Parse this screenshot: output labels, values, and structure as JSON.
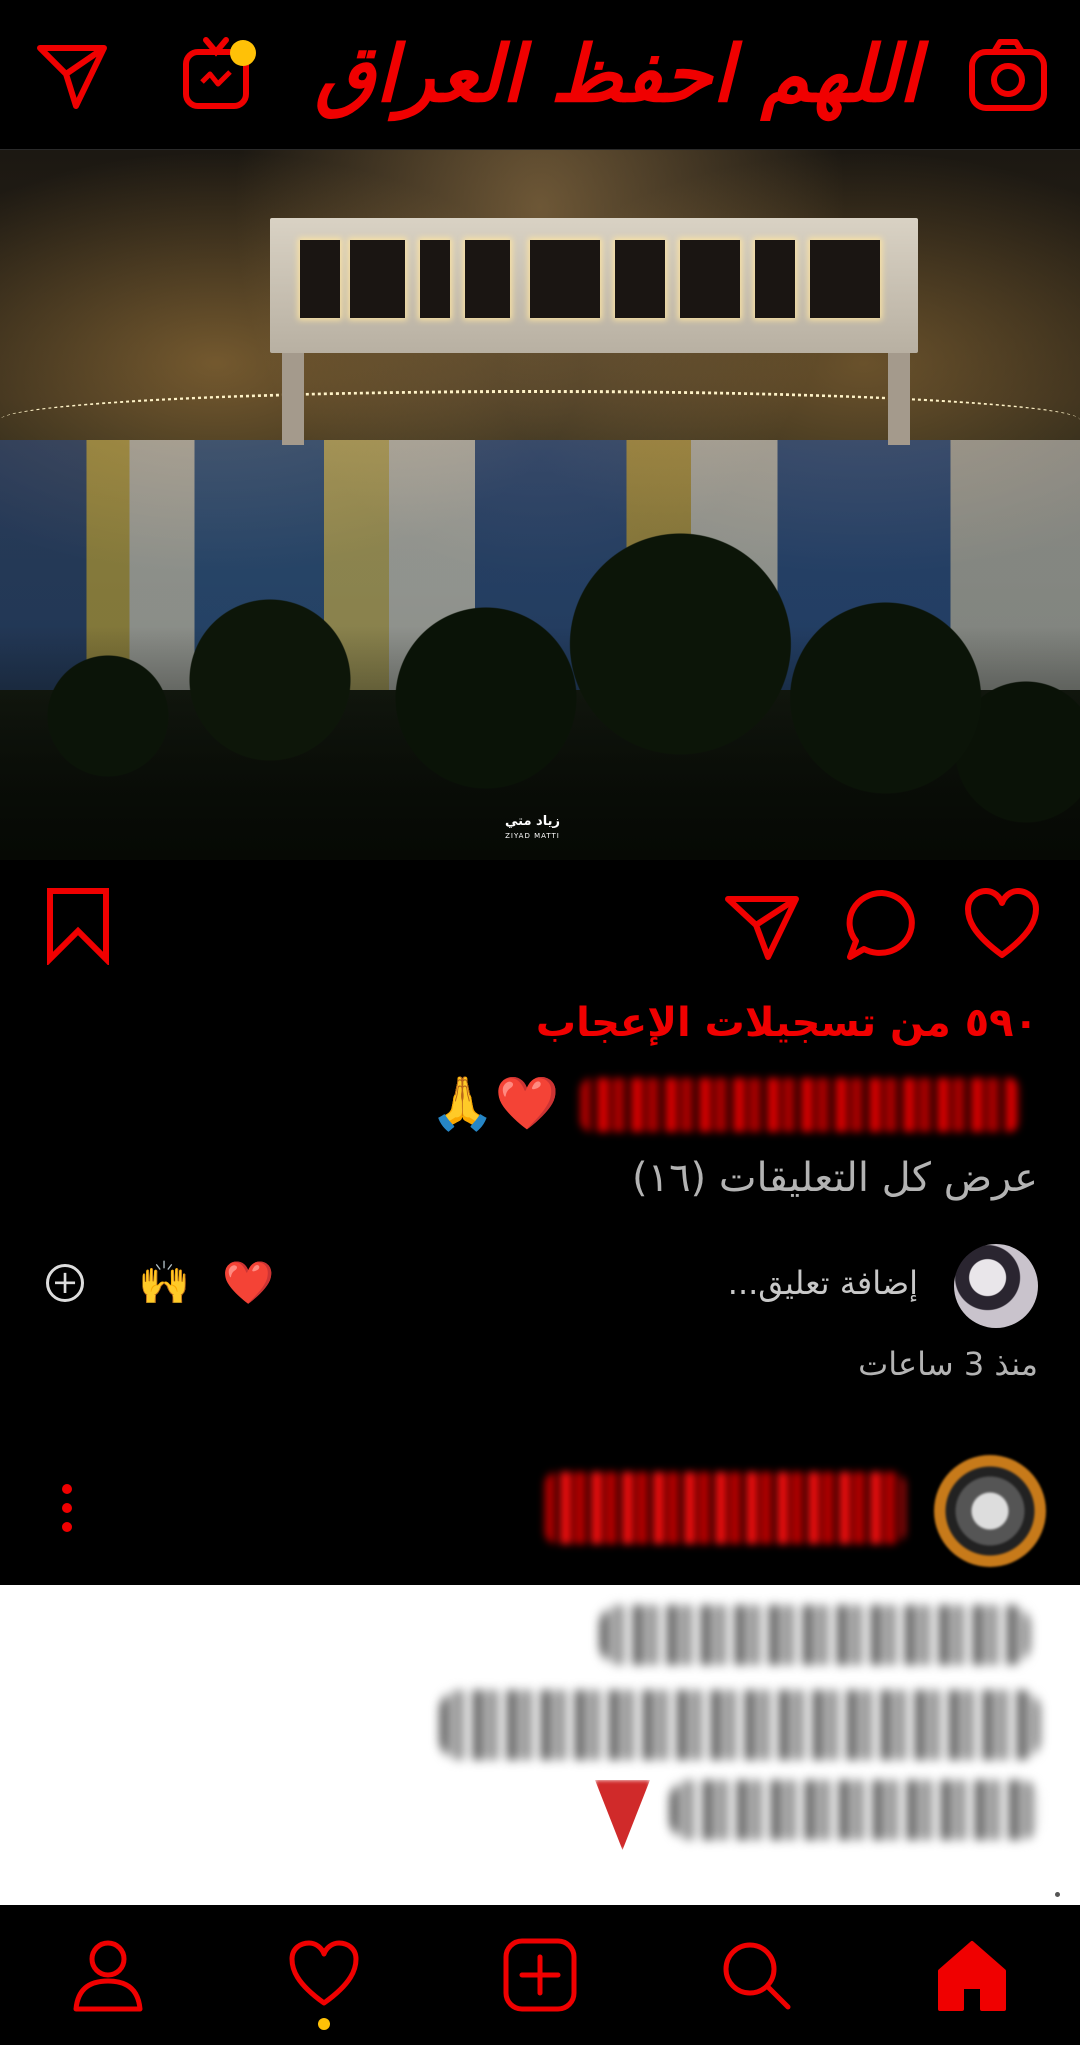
{
  "app": {
    "header_title": "اللهم احفظ العراق",
    "accent_color": "#f00000",
    "notification_dot_color": "#ffc107"
  },
  "header_icons": {
    "left_1": "send-icon",
    "left_2": "igtv-icon",
    "right": "camera-icon"
  },
  "post": {
    "image_watermark": "زياد متي",
    "image_watermark_latin": "ZIYAD MATTI",
    "action_icons": [
      "bookmark-icon",
      "send-icon",
      "comment-icon",
      "heart-icon"
    ],
    "likes_text": "٥٩٠ من تسجيلات الإعجاب",
    "caption_emoji": "🙏❤️",
    "view_comments": "عرض كل التعليقات (١٦)",
    "add_comment_placeholder": "إضافة تعليق...",
    "quick_reactions": [
      "❤️",
      "🙌"
    ],
    "time_ago": "منذ 3 ساعات"
  },
  "bottom_nav": {
    "items": [
      "profile-icon",
      "activity-heart-icon",
      "new-post-icon",
      "search-icon",
      "home-icon"
    ],
    "active": "home-icon"
  }
}
